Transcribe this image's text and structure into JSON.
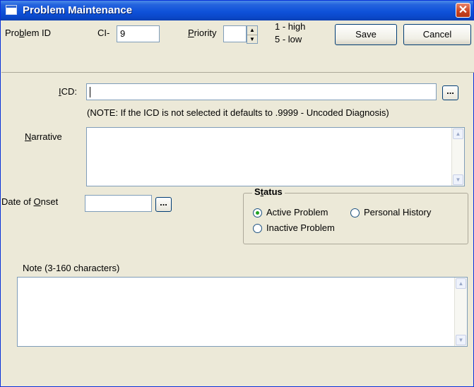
{
  "window": {
    "title": "Problem Maintenance",
    "close_glyph": "✕"
  },
  "header": {
    "problem_id_label_pre": "Pro",
    "problem_id_label_key": "b",
    "problem_id_label_post": "lem ID",
    "ci_prefix": "CI-",
    "ci_value": "9",
    "priority_label_key": "P",
    "priority_label_post": "riority",
    "priority_value": "",
    "priority_hint_high": "1 - high",
    "priority_hint_low": "5 - low",
    "save_label": "Save",
    "cancel_label": "Cancel"
  },
  "icd": {
    "label_key": "I",
    "label_post": "CD:",
    "value": "",
    "browse_label": "...",
    "note": "(NOTE: If the  ICD is not selected it defaults to .9999 - Uncoded Diagnosis)"
  },
  "narrative": {
    "label_key": "N",
    "label_post": "arrative",
    "value": ""
  },
  "onset": {
    "label_pre": "Date of ",
    "label_key": "O",
    "label_post": "nset",
    "value": "",
    "browse_label": "..."
  },
  "status": {
    "legend_pre": "S",
    "legend_key": "t",
    "legend_post": "atus",
    "options": [
      "Active Problem",
      "Personal History",
      "Inactive Problem"
    ],
    "selected": "Active Problem"
  },
  "note": {
    "label": "Note (3-160 characters)",
    "value": ""
  },
  "scroll": {
    "up_glyph": "▲",
    "down_glyph": "▼"
  }
}
